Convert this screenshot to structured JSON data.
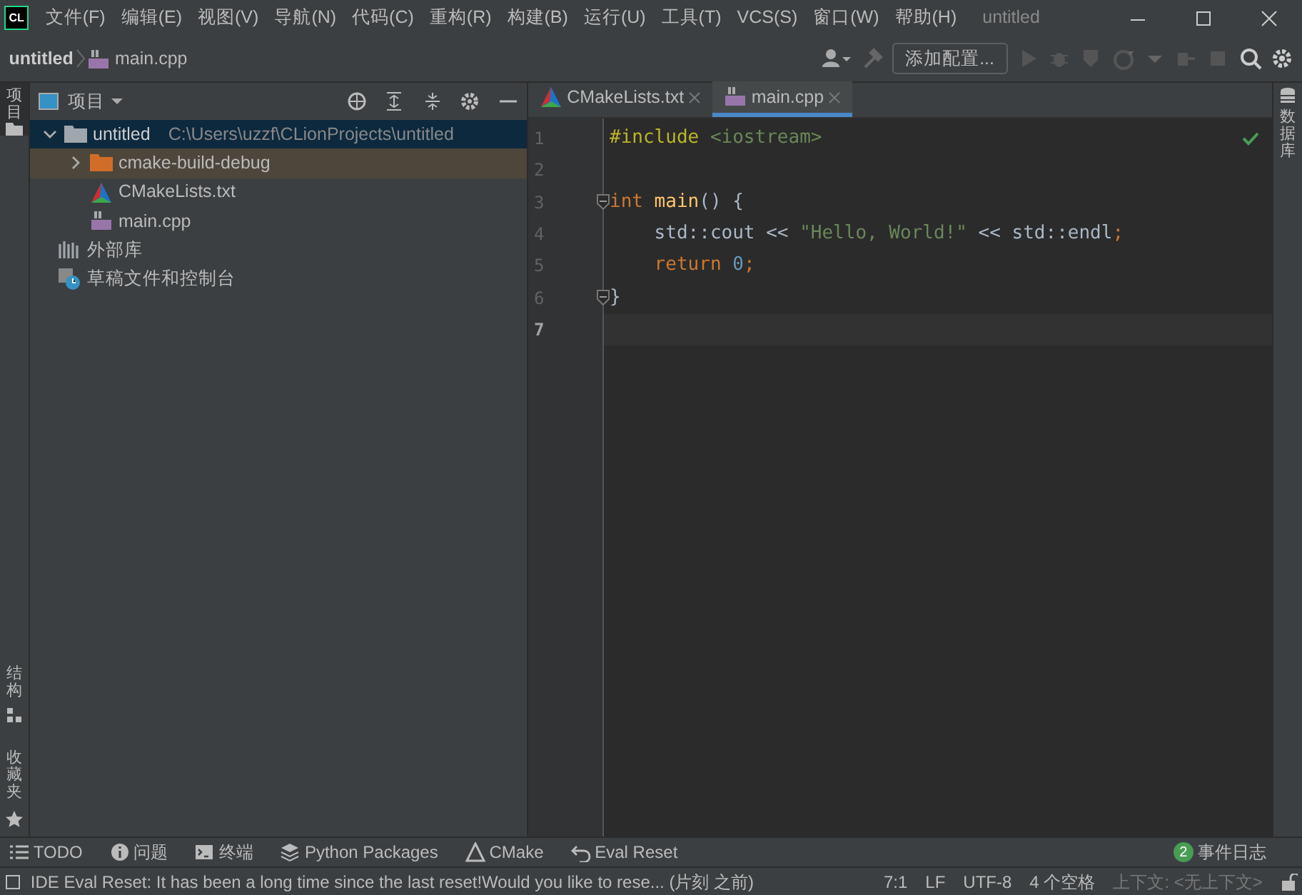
{
  "title_bar": {
    "menus": [
      "文件(F)",
      "编辑(E)",
      "视图(V)",
      "导航(N)",
      "代码(C)",
      "重构(R)",
      "构建(B)",
      "运行(U)",
      "工具(T)",
      "VCS(S)",
      "窗口(W)",
      "帮助(H)"
    ],
    "title": "untitled",
    "logo": "CL"
  },
  "nav_bar": {
    "breadcrumb": [
      "untitled",
      "main.cpp"
    ],
    "config_button": "添加配置..."
  },
  "left_strip": {
    "top": "项目",
    "bottom": [
      "结构",
      "收藏夹"
    ]
  },
  "right_strip": {
    "label": "数据库"
  },
  "project_panel": {
    "title": "项目",
    "tree": [
      {
        "label": "untitled",
        "path": "C:\\Users\\uzzf\\CLionProjects\\untitled",
        "kind": "folder",
        "expanded": true,
        "selected": true,
        "excluded": false,
        "children": [
          {
            "label": "cmake-build-debug",
            "kind": "folder-excluded",
            "expanded": false,
            "selected": false,
            "excluded": true
          },
          {
            "label": "CMakeLists.txt",
            "kind": "cmake",
            "selected": false,
            "excluded": false
          },
          {
            "label": "main.cpp",
            "kind": "cpp",
            "selected": false,
            "excluded": false
          }
        ]
      },
      {
        "label": "外部库",
        "kind": "library",
        "selected": false,
        "excluded": false
      },
      {
        "label": "草稿文件和控制台",
        "kind": "scratch",
        "selected": false,
        "excluded": false
      }
    ]
  },
  "editor": {
    "tabs": [
      {
        "label": "CMakeLists.txt",
        "kind": "cmake",
        "selected": false
      },
      {
        "label": "main.cpp",
        "kind": "cpp",
        "selected": true
      }
    ],
    "lines": [
      {
        "number": "1",
        "current": false,
        "fold": false,
        "tokens": [
          {
            "text": "#include",
            "kind": "directive"
          },
          {
            "text": " <iostream>",
            "kind": "string"
          }
        ]
      },
      {
        "number": "2",
        "current": false,
        "fold": false
      },
      {
        "number": "3",
        "current": false,
        "fold": true,
        "tokens": [
          {
            "text": "int",
            "kind": "keyword"
          },
          {
            "text": " main",
            "kind": "function"
          },
          {
            "text": "() {",
            "kind": "plain"
          }
        ]
      },
      {
        "number": "4",
        "current": false,
        "fold": false,
        "tokens": [
          {
            "text": "    std::cout << ",
            "kind": "plain"
          },
          {
            "text": "\"Hello, World!\"",
            "kind": "string"
          },
          {
            "text": " << std::endl",
            "kind": "plain"
          },
          {
            "text": ";",
            "kind": "keyword"
          }
        ]
      },
      {
        "number": "5",
        "current": false,
        "fold": false,
        "tokens": [
          {
            "text": "    return",
            "kind": "keyword"
          },
          {
            "text": " 0",
            "kind": "number"
          },
          {
            "text": ";",
            "kind": "keyword"
          }
        ]
      },
      {
        "number": "6",
        "current": false,
        "fold": true,
        "tokens": [
          {
            "text": "}",
            "kind": "plain"
          }
        ]
      },
      {
        "number": "7",
        "current": true,
        "fold": false
      }
    ]
  },
  "tool_bar": {
    "items": [
      {
        "label": "TODO",
        "kind": "list"
      },
      {
        "label": "问题",
        "kind": "info"
      },
      {
        "label": "终端",
        "kind": "terminal"
      },
      {
        "label": "Python Packages",
        "kind": "layers"
      },
      {
        "label": "CMake",
        "kind": "triangle"
      },
      {
        "label": "Eval Reset",
        "kind": "undo"
      }
    ],
    "event_count": "2",
    "event_log": "事件日志"
  },
  "status_bar": {
    "message": "IDE Eval Reset: It has been a long time since the last reset!Would you like to rese... (片刻 之前)",
    "items": [
      {
        "text": "7:1",
        "muted": false
      },
      {
        "text": "LF",
        "muted": false
      },
      {
        "text": "UTF-8",
        "muted": false
      },
      {
        "text": "4 个空格",
        "muted": false
      },
      {
        "text": "上下文: <无上下文>",
        "muted": true
      }
    ]
  }
}
